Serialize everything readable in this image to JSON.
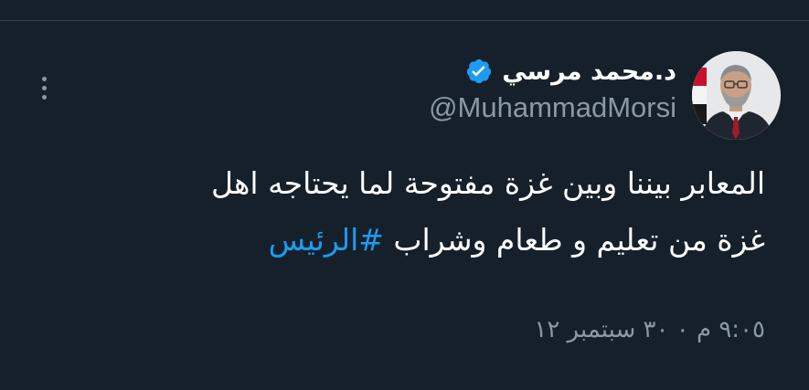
{
  "tweet": {
    "author": {
      "display_name": "د.محمد مرسي",
      "handle": "@MuhammadMorsi",
      "verified": true,
      "avatar_icon": "profile-photo"
    },
    "text_line_1": "المعابر بيننا وبين غزة مفتوحة لما يحتاجه اهل",
    "text_line_2": "غزة من تعليم و طعام وشراب",
    "hashtag": "#الرئيس",
    "timestamp": "٩:٠٥ م ٠ ٣٠ سبتمبر ١٢",
    "more_icon": "vertical-ellipsis-icon"
  },
  "theme": {
    "background": "#15202b",
    "divider": "#38444d",
    "text_primary": "#ffffff",
    "text_secondary": "#8b98a5",
    "accent": "#1d9bf0"
  }
}
